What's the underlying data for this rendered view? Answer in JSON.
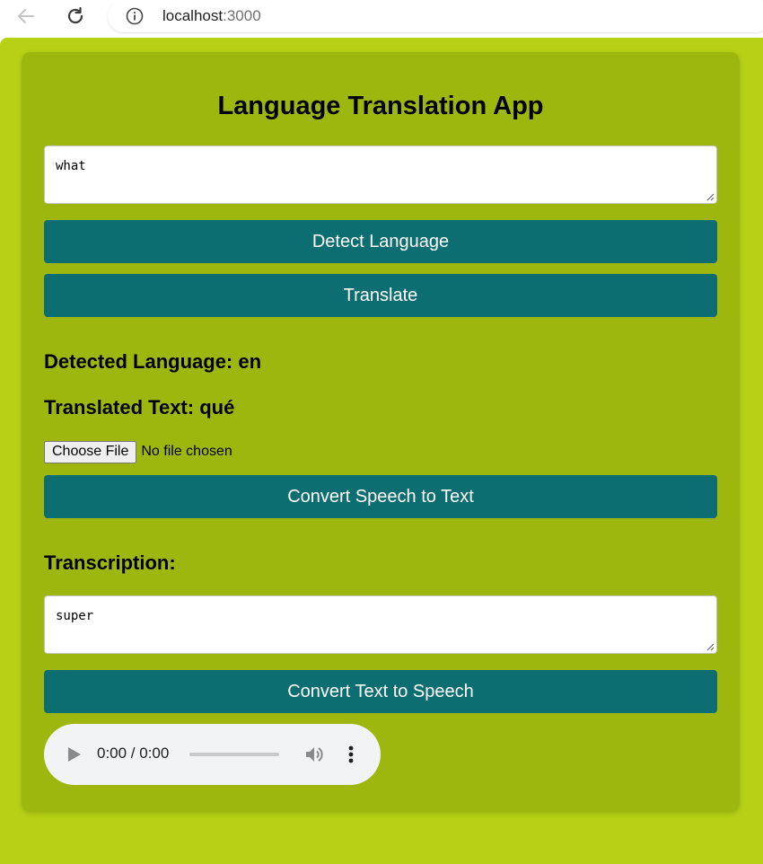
{
  "browser": {
    "url_host": "localhost",
    "url_port": ":3000"
  },
  "app": {
    "title": "Language Translation App",
    "input_text": "what",
    "detect_button": "Detect Language",
    "translate_button": "Translate",
    "detected_language": "Detected Language: en",
    "translated_text": "Translated Text: qué",
    "choose_file_button": "Choose File",
    "file_status": "No file chosen",
    "speech_to_text_button": "Convert Speech to Text",
    "transcription_label": "Transcription:",
    "transcription_text": "super",
    "text_to_speech_button": "Convert Text to Speech",
    "audio": {
      "time": "0:00 / 0:00"
    }
  },
  "colors": {
    "page_background": "#b6d116",
    "card_background": "#9db70f",
    "button_background": "#0d6e72",
    "button_text": "#ffffff"
  },
  "icons": [
    "back-arrow-icon",
    "reload-icon",
    "info-icon",
    "play-icon",
    "volume-icon",
    "more-vert-icon",
    "resize-grip-icon"
  ]
}
